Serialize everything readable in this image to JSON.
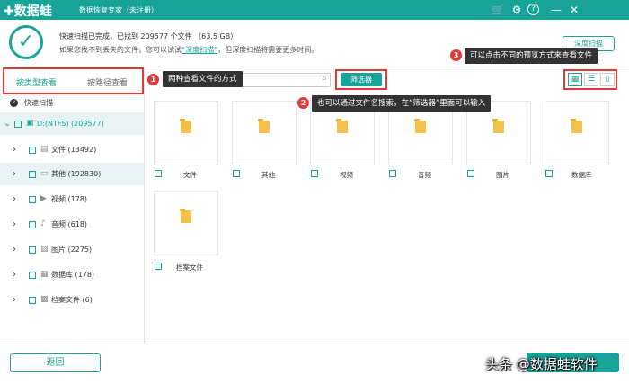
{
  "titlebar": {
    "logo_text": "✚数据蛙",
    "subtitle": "数据恢复专家（未注册）",
    "icons": [
      "cart-icon",
      "settings-icon",
      "help-icon",
      "minimize-icon",
      "close-icon"
    ],
    "icon_glyphs": [
      "🛒",
      "⚙",
      "?",
      "—",
      "✕"
    ]
  },
  "status": {
    "line1": "快速扫描已完成，已找到 209577 个文件 （63.5 GB）",
    "line2_pre": "如果您找不到丢失的文件，您可以试试",
    "line2_link": "“深度扫描”",
    "line2_post": "，但深度扫描将需要更多时间。",
    "deep_scan_button": "深度扫描"
  },
  "sidebar": {
    "tab_by_type": "按类型查看",
    "tab_by_path": "按路径查看",
    "quick_scan": "快速扫描",
    "items": [
      {
        "label": "D:(NTFS) (209577)",
        "icon": "drive-icon",
        "glyph": "▣"
      },
      {
        "label": "文件 (13492)",
        "icon": "document-icon",
        "glyph": "▤"
      },
      {
        "label": "其他 (192830)",
        "icon": "folder-icon",
        "glyph": "▭"
      },
      {
        "label": "视频 (178)",
        "icon": "video-icon",
        "glyph": "▶"
      },
      {
        "label": "音频 (618)",
        "icon": "audio-icon",
        "glyph": "♪"
      },
      {
        "label": "图片 (2275)",
        "icon": "image-icon",
        "glyph": "▨"
      },
      {
        "label": "数据库 (178)",
        "icon": "database-icon",
        "glyph": "▦"
      },
      {
        "label": "档案文件 (6)",
        "icon": "archive-icon",
        "glyph": "▩"
      }
    ]
  },
  "toolbar": {
    "search_placeholder": "",
    "filter_button": "筛选器",
    "view_modes": [
      "grid-view-icon",
      "list-view-icon",
      "detail-view-icon"
    ],
    "view_glyphs": [
      "▦",
      "☰",
      "▯"
    ]
  },
  "tooltips": [
    {
      "num": "1",
      "text": "两种查看文件的方式"
    },
    {
      "num": "2",
      "text": "也可以通过文件名搜索，在“筛选器”里面可以输入"
    },
    {
      "num": "3",
      "text": "可以点击不同的预览方式来查看文件"
    }
  ],
  "tiles": [
    "文件",
    "其他",
    "视频",
    "音频",
    "图片",
    "数据库",
    "档案文件"
  ],
  "bottom": {
    "back_button": "返回",
    "watermark": "头条 @数据蛙软件"
  },
  "colors": {
    "accent": "#17a398",
    "highlight": "#e03a36",
    "tooltip_bg": "#333333"
  }
}
